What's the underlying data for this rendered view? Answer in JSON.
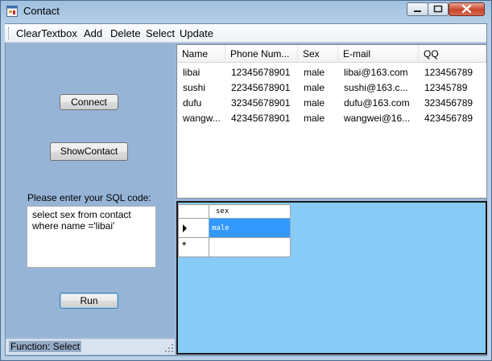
{
  "window": {
    "title": "Contact"
  },
  "menu": {
    "items": [
      "ClearTextbox",
      "Add",
      "Delete",
      "Select",
      "Update"
    ]
  },
  "left": {
    "connect_label": "Connect",
    "show_label": "ShowContact",
    "sql_label": "Please enter your SQL code:",
    "sql_value": "select sex from contact\nwhere name ='libai'",
    "run_label": "Run"
  },
  "status": {
    "text": "Function: Select"
  },
  "contacts": {
    "columns": [
      "Name",
      "Phone Num...",
      "Sex",
      "E-mail",
      "QQ"
    ],
    "rows": [
      [
        "libai",
        "12345678901",
        "male",
        "libai@163.com",
        "123456789"
      ],
      [
        "sushi",
        "22345678901",
        "male",
        "sushi@163.c...",
        "12345789"
      ],
      [
        "dufu",
        "32345678901",
        "male",
        "dufu@163.com",
        "323456789"
      ],
      [
        "wangw...",
        "42345678901",
        "male",
        "wangwei@16...",
        "423456789"
      ]
    ]
  },
  "result_grid": {
    "column": "sex",
    "rows": [
      "male"
    ],
    "new_row_marker": "*"
  },
  "colors": {
    "selection": "#3399ff",
    "grid_background": "#87cbf6",
    "panel": "#96b5d6"
  }
}
